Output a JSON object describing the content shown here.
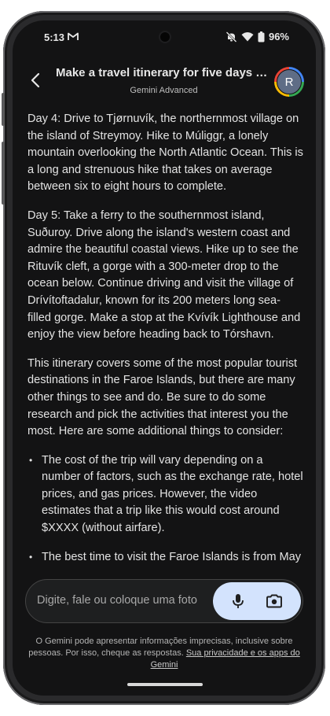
{
  "status_bar": {
    "time": "5:13",
    "battery": "96%"
  },
  "header": {
    "title": "Make a travel itinerary for five days on ...",
    "subtitle": "Gemini Advanced",
    "avatar_letter": "R"
  },
  "response": {
    "paragraphs": [
      "Day 4: Drive to Tjørnuvík, the northernmost village on the island of Streymoy. Hike to Múliggr, a lonely mountain overlooking the North Atlantic Ocean. This is a long and strenuous hike that takes on average between six to eight hours to complete.",
      "Day 5: Take a ferry to the southernmost island, Suðuroy. Drive along the island's western coast and admire the beautiful coastal views. Hike up to see the Rituvík cleft, a gorge with a 300-meter drop to the ocean below.  Continue driving and visit the village of Drívítoftadalur, known for its 200 meters long sea-filled gorge.  Make a stop at the Kvívík Lighthouse and enjoy the view before heading back to Tórshavn.",
      "This itinerary covers some of the most popular tourist destinations in the Faroe Islands, but there are many other things to see and do. Be sure to do some research and pick the activities that interest you the most. Here are some additional things to consider:"
    ],
    "bullets": [
      "The cost of the trip will vary depending on a number of factors, such as the exchange rate, hotel prices, and gas prices. However, the video estimates that a trip like this would cost around $XXXX (without airfare).",
      "The best time to visit the Faroe Islands is from May to September, when the weather is mildest."
    ]
  },
  "input": {
    "placeholder": "Digite, fale ou coloque uma foto"
  },
  "disclaimer": {
    "text": "O Gemini pode apresentar informações imprecisas, inclusive sobre pessoas. Por isso, cheque as respostas. ",
    "link": "Sua privacidade e os apps do Gemini"
  },
  "colors": {
    "screen_bg": "#131314",
    "action_pill": "#d3e3fd",
    "text": "#e3e3e3"
  },
  "icons": [
    "gmail-icon",
    "mute-icon",
    "wifi-icon",
    "battery-icon",
    "back-arrow-icon",
    "microphone-icon",
    "camera-icon"
  ]
}
